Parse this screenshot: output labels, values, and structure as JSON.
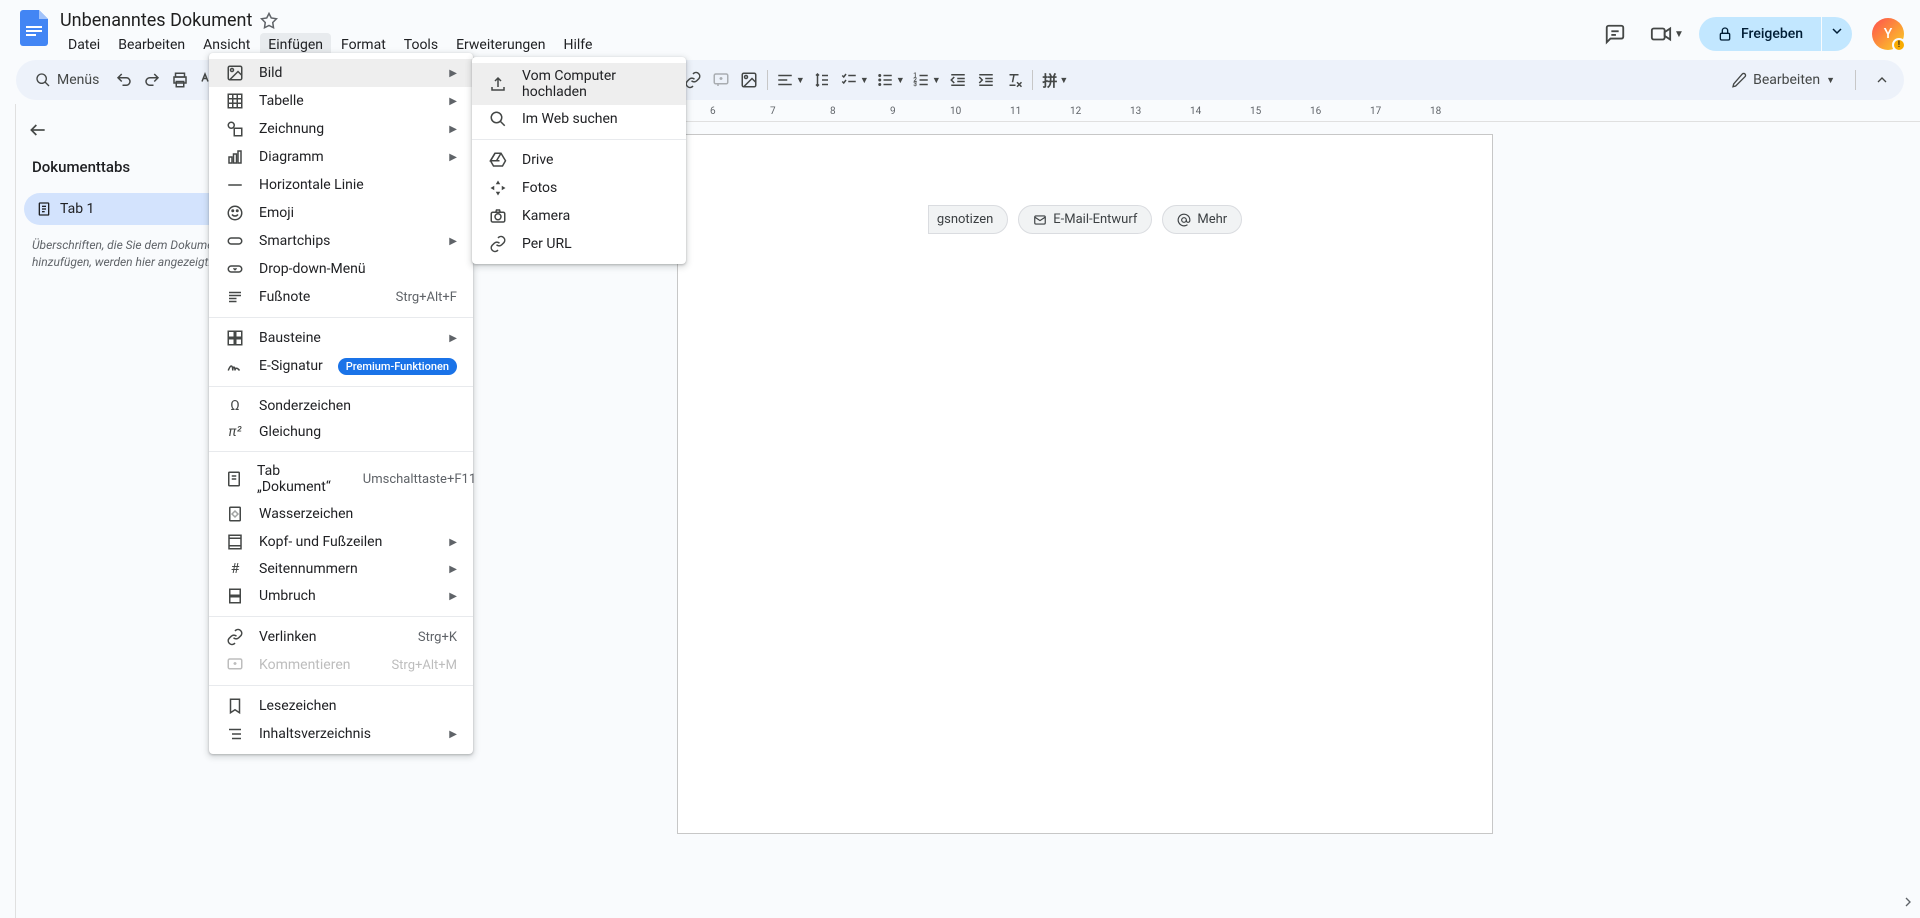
{
  "doc_title": "Unbenanntes Dokument",
  "menubar": [
    "Datei",
    "Bearbeiten",
    "Ansicht",
    "Einfügen",
    "Format",
    "Tools",
    "Erweiterungen",
    "Hilfe"
  ],
  "toolbar_search": "Menüs",
  "edit_mode": "Bearbeiten",
  "share_label": "Freigeben",
  "avatar_letter": "Y",
  "sidebar": {
    "tabs_title": "Dokumenttabs",
    "tab1": "Tab 1",
    "headings_hint": "Überschriften, die Sie dem Dokument hinzufügen, werden hier angezeigt."
  },
  "chips": {
    "notes": "gsnotizen",
    "email": "E-Mail-Entwurf",
    "more": "Mehr"
  },
  "insert_menu": {
    "bild": "Bild",
    "tabelle": "Tabelle",
    "zeichnung": "Zeichnung",
    "diagramm": "Diagramm",
    "hline": "Horizontale Linie",
    "emoji": "Emoji",
    "smartchips": "Smartchips",
    "dropdown": "Drop-down-Menü",
    "fussnote": "Fußnote",
    "fussnote_sc": "Strg+Alt+F",
    "bausteine": "Bausteine",
    "esignatur": "E-Signatur",
    "premium": "Premium-Funktionen",
    "sonderzeichen": "Sonderzeichen",
    "gleichung": "Gleichung",
    "tabdok": "Tab „Dokument“",
    "tabdok_sc": "Umschalttaste+F11",
    "wasserzeichen": "Wasserzeichen",
    "kopffuss": "Kopf- und Fußzeilen",
    "seitennummern": "Seitennummern",
    "umbruch": "Umbruch",
    "verlinken": "Verlinken",
    "verlinken_sc": "Strg+K",
    "kommentieren": "Kommentieren",
    "kommentieren_sc": "Strg+Alt+M",
    "lesezeichen": "Lesezeichen",
    "inhaltsverzeichnis": "Inhaltsverzeichnis"
  },
  "image_menu": {
    "upload": "Vom Computer hochladen",
    "websearch": "Im Web suchen",
    "drive": "Drive",
    "fotos": "Fotos",
    "kamera": "Kamera",
    "url": "Per URL"
  },
  "ruler_marks": [
    "6",
    "7",
    "8",
    "9",
    "10",
    "11",
    "12",
    "13",
    "14",
    "15",
    "16",
    "17",
    "18"
  ]
}
